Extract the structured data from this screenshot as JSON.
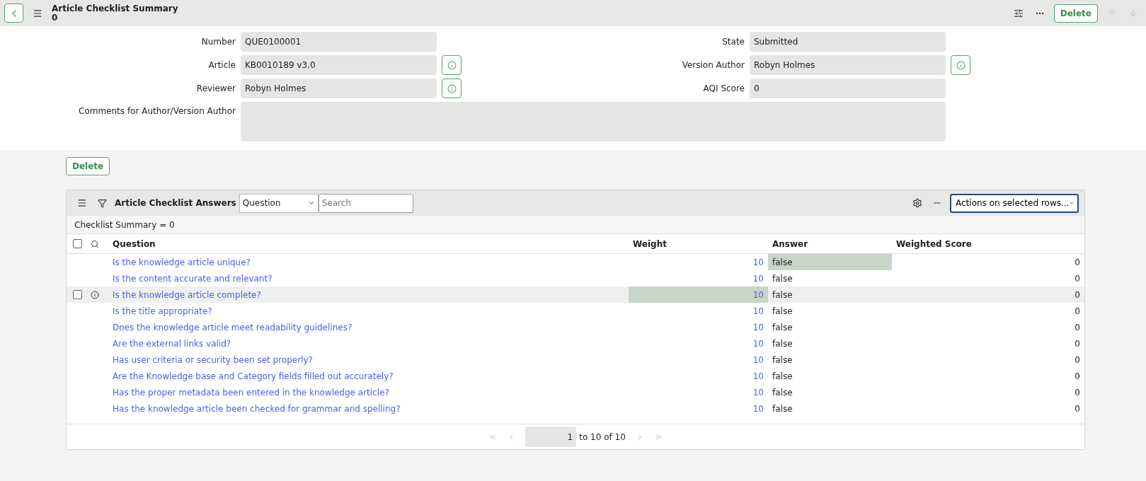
{
  "header": {
    "title": "Article Checklist Summary",
    "subtitle": "0",
    "delete_label": "Delete"
  },
  "form": {
    "left": [
      {
        "label": "Number",
        "value": "QUE0100001",
        "info": false
      },
      {
        "label": "Article",
        "value": "KB0010189 v3.0",
        "info": true
      },
      {
        "label": "Reviewer",
        "value": "Robyn Holmes",
        "info": true
      }
    ],
    "right": [
      {
        "label": "State",
        "value": "Submitted",
        "info": false
      },
      {
        "label": "Version Author",
        "value": "Robyn Holmes",
        "info": true
      },
      {
        "label": "AQI Score",
        "value": "0",
        "info": false
      }
    ],
    "comments": {
      "label": "Comments for Author/Version Author"
    }
  },
  "delete_label": "Delete",
  "list": {
    "title": "Article Checklist Answers",
    "search_field": "Question",
    "search_placeholder": "Search",
    "actions": "Actions on selected rows...",
    "breadcrumb": "Checklist Summary = 0",
    "select_all_checked": false,
    "columns": [
      "Question",
      "Weight",
      "Answer",
      "Weighted Score"
    ],
    "rows": [
      {
        "question": "Is the knowledge article unique?",
        "weight": "10",
        "answer": "false",
        "score": "0",
        "hovered": false,
        "weight_highlighted": false,
        "answer_highlighted": true
      },
      {
        "question": "Is the content accurate and relevant?",
        "weight": "10",
        "answer": "false",
        "score": "0",
        "hovered": false,
        "weight_highlighted": false,
        "answer_highlighted": false
      },
      {
        "question": "Is the knowledge article complete?",
        "weight": "10",
        "answer": "false",
        "score": "0",
        "hovered": true,
        "checked": false,
        "weight_highlighted": true,
        "answer_highlighted": false
      },
      {
        "question": "Is the title appropriate?",
        "weight": "10",
        "answer": "false",
        "score": "0",
        "hovered": false,
        "weight_highlighted": false,
        "answer_highlighted": false
      },
      {
        "question": "Does the knowledge article meet readability guidelines?",
        "weight": "10",
        "answer": "false",
        "score": "0",
        "hovered": false,
        "weight_highlighted": false,
        "answer_highlighted": false
      },
      {
        "question": "Are the external links valid?",
        "weight": "10",
        "answer": "false",
        "score": "0",
        "hovered": false,
        "weight_highlighted": false,
        "answer_highlighted": false
      },
      {
        "question": "Has user criteria or security been set properly?",
        "weight": "10",
        "answer": "false",
        "score": "0",
        "hovered": false,
        "weight_highlighted": false,
        "answer_highlighted": false
      },
      {
        "question": "Are the Knowledge base and Category fields filled out accurately?",
        "weight": "10",
        "answer": "false",
        "score": "0",
        "hovered": false,
        "weight_highlighted": false,
        "answer_highlighted": false
      },
      {
        "question": "Has the proper metadata been entered in the knowledge article?",
        "weight": "10",
        "answer": "false",
        "score": "0",
        "hovered": false,
        "weight_highlighted": false,
        "answer_highlighted": false
      },
      {
        "question": "Has the knowledge article been checked for grammar and spelling?",
        "weight": "10",
        "answer": "false",
        "score": "0",
        "hovered": false,
        "weight_highlighted": false,
        "answer_highlighted": false
      }
    ],
    "pager": {
      "page": "1",
      "range": "to 10 of 10"
    }
  }
}
